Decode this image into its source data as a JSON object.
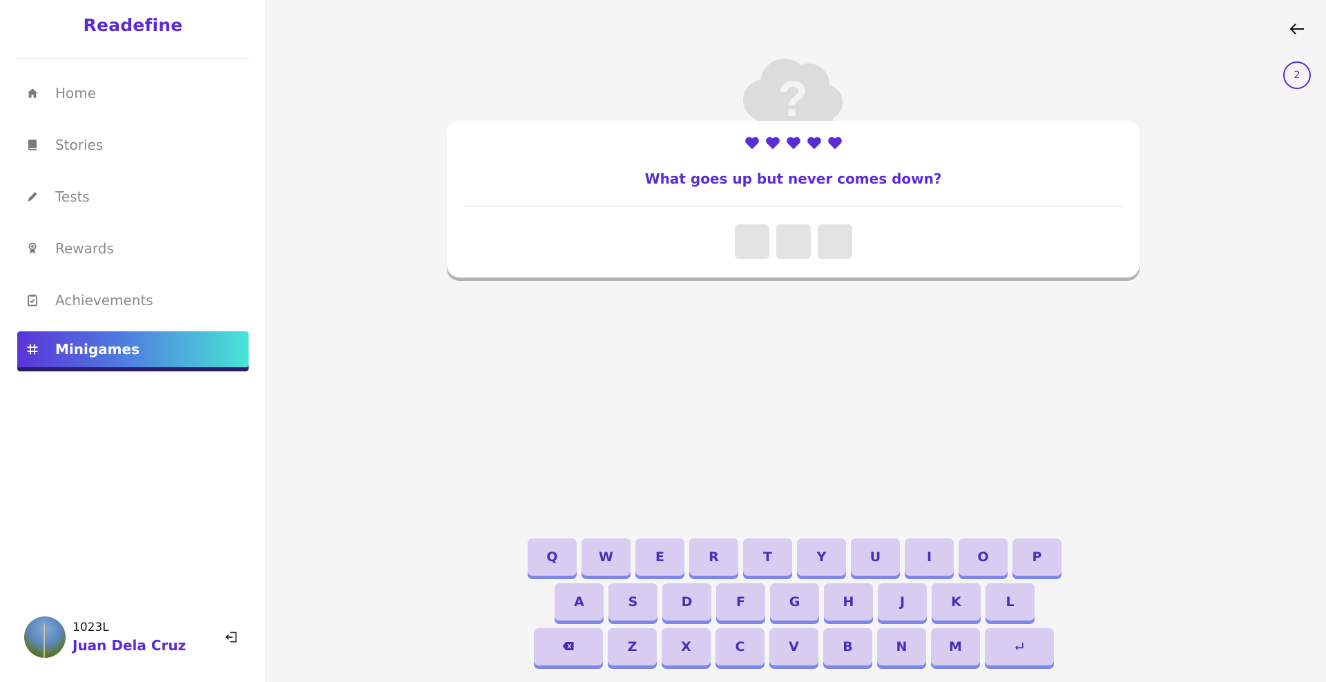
{
  "app": {
    "brand": "Readefine"
  },
  "sidebar": {
    "items": [
      {
        "label": "Home",
        "icon": "home-icon"
      },
      {
        "label": "Stories",
        "icon": "book-icon"
      },
      {
        "label": "Tests",
        "icon": "pencil-icon"
      },
      {
        "label": "Rewards",
        "icon": "award-icon"
      },
      {
        "label": "Achievements",
        "icon": "clipboard-check-icon"
      },
      {
        "label": "Minigames",
        "icon": "grid-icon",
        "active": true
      }
    ]
  },
  "user": {
    "id": "1023L",
    "name": "Juan Dela Cruz"
  },
  "game": {
    "level": "2",
    "lives": 5,
    "question": "What goes up but never comes down?",
    "answer_slots": 3
  },
  "keyboard": {
    "row1": [
      "Q",
      "W",
      "E",
      "R",
      "T",
      "Y",
      "U",
      "I",
      "O",
      "P"
    ],
    "row2": [
      "A",
      "S",
      "D",
      "F",
      "G",
      "H",
      "J",
      "K",
      "L"
    ],
    "row3": [
      "Z",
      "X",
      "C",
      "V",
      "B",
      "N",
      "M"
    ],
    "backspace_icon": "backspace-icon",
    "enter_icon": "enter-icon"
  },
  "colors": {
    "accent": "#5b2bd6",
    "key_bg": "#d8cdf0",
    "key_shadow": "#7d86ec"
  }
}
